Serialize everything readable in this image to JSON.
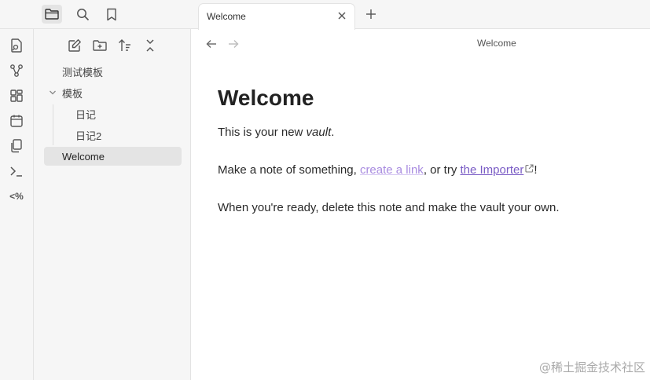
{
  "ribbon": {
    "items": [
      {
        "name": "open-quick-switcher-icon"
      },
      {
        "name": "graph-view-icon"
      },
      {
        "name": "canvas-icon"
      },
      {
        "name": "daily-note-icon"
      },
      {
        "name": "templates-icon"
      },
      {
        "name": "command-palette-icon"
      },
      {
        "name": "templater-icon",
        "label": "<%"
      }
    ]
  },
  "sidebar": {
    "tabs": [
      {
        "name": "files-tab",
        "active": true
      },
      {
        "name": "search-tab",
        "active": false
      },
      {
        "name": "bookmarks-tab",
        "active": false
      }
    ],
    "tree": [
      {
        "label": "测试模板",
        "type": "file",
        "depth": 0
      },
      {
        "label": "模板",
        "type": "folder",
        "depth": 0,
        "expanded": true
      },
      {
        "label": "日记",
        "type": "file",
        "depth": 1
      },
      {
        "label": "日记2",
        "type": "file",
        "depth": 1
      },
      {
        "label": "Welcome",
        "type": "file",
        "depth": 0,
        "active": true
      }
    ]
  },
  "tabs": [
    {
      "label": "Welcome",
      "active": true
    }
  ],
  "view": {
    "title": "Welcome"
  },
  "note": {
    "heading": "Welcome",
    "p1_prefix": "This is your new ",
    "p1_em": "vault",
    "p1_suffix": ".",
    "p2_prefix": "Make a note of something, ",
    "p2_link": "create a link",
    "p2_middle": ", or try ",
    "p2_link2": "the Importer",
    "p2_suffix": "!",
    "p3": "When you're ready, delete this note and make the vault your own."
  },
  "watermark": "@稀土掘金技术社区",
  "colors": {
    "accent": "#7a5cc5",
    "internal_link": "#a88be0",
    "sidebar_bg": "#f6f6f6"
  }
}
